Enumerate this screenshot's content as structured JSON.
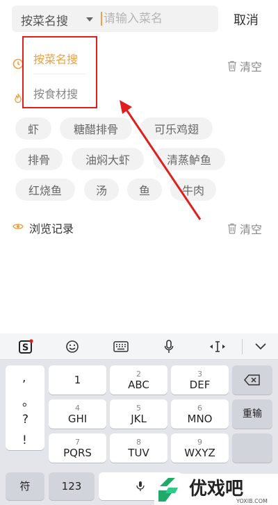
{
  "search": {
    "mode_label": "按菜名搜",
    "placeholder": "请输入菜名",
    "value": "",
    "cancel_label": "取消"
  },
  "dropdown": {
    "items": [
      {
        "label": "按菜名搜",
        "active": true
      },
      {
        "label": "按食材搜",
        "active": false
      }
    ]
  },
  "history": {
    "clear_label": "清空",
    "icon": "clock-icon"
  },
  "hot": {
    "icon": "flame-icon",
    "tags": [
      "虾",
      "糖醋排骨",
      "可乐鸡翅",
      "排骨",
      "油焖大虾",
      "清蒸鲈鱼",
      "红烧鱼",
      "汤",
      "鱼",
      "牛肉"
    ]
  },
  "browse": {
    "title": "浏览记录",
    "clear_label": "清空",
    "icon": "eye-icon"
  },
  "keyboard": {
    "punct": [
      ",",
      "。",
      "?",
      "!"
    ],
    "keys": [
      {
        "num": "",
        "lbl": "1"
      },
      {
        "num": "2",
        "lbl": "ABC"
      },
      {
        "num": "3",
        "lbl": "DEF"
      },
      {
        "num": "4",
        "lbl": "GHI"
      },
      {
        "num": "5",
        "lbl": "JKL"
      },
      {
        "num": "6",
        "lbl": "MNO"
      },
      {
        "num": "7",
        "lbl": "PQRS"
      },
      {
        "num": "8",
        "lbl": "TUV"
      },
      {
        "num": "9",
        "lbl": "WXYZ"
      }
    ],
    "reenter_label": "重输",
    "symbol_label": "符",
    "num_label": "123",
    "watermark": {
      "brand": "优戏吧",
      "url": "YOXIB.COM"
    }
  },
  "colors": {
    "accent": "#f0a040",
    "highlight_box": "#e21d1d",
    "tag_bg": "#f2f2f2"
  }
}
